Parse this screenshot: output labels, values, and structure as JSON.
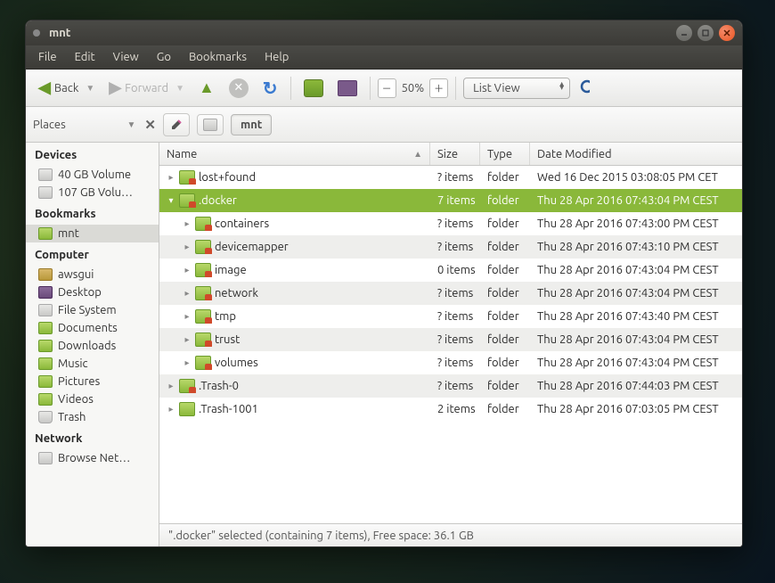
{
  "window": {
    "title": "mnt"
  },
  "menubar": [
    "File",
    "Edit",
    "View",
    "Go",
    "Bookmarks",
    "Help"
  ],
  "toolbar": {
    "back": "Back",
    "forward": "Forward",
    "zoom": "50%",
    "view_mode": "List View"
  },
  "locbar": {
    "places": "Places",
    "crumb": "mnt"
  },
  "sidebar": {
    "sections": [
      {
        "title": "Devices",
        "items": [
          {
            "icon": "drive",
            "label": "40 GB Volume"
          },
          {
            "icon": "drive",
            "label": "107 GB Volu…"
          }
        ]
      },
      {
        "title": "Bookmarks",
        "items": [
          {
            "icon": "folder",
            "label": "mnt",
            "selected": true
          }
        ]
      },
      {
        "title": "Computer",
        "items": [
          {
            "icon": "home",
            "label": "awsgui"
          },
          {
            "icon": "desktop",
            "label": "Desktop"
          },
          {
            "icon": "drive",
            "label": "File System"
          },
          {
            "icon": "folder",
            "label": "Documents"
          },
          {
            "icon": "folder",
            "label": "Downloads"
          },
          {
            "icon": "folder",
            "label": "Music"
          },
          {
            "icon": "folder",
            "label": "Pictures"
          },
          {
            "icon": "folder",
            "label": "Videos"
          },
          {
            "icon": "trash",
            "label": "Trash"
          }
        ]
      },
      {
        "title": "Network",
        "items": [
          {
            "icon": "drive",
            "label": "Browse Net…"
          }
        ]
      }
    ]
  },
  "columns": {
    "name": "Name",
    "size": "Size",
    "type": "Type",
    "date": "Date Modified"
  },
  "rows": [
    {
      "depth": 0,
      "exp": "▸",
      "locked": true,
      "name": "lost+found",
      "size": "? items",
      "type": "folder",
      "date": "Wed 16 Dec 2015 03:08:05 PM CET",
      "alt": false,
      "sel": false
    },
    {
      "depth": 0,
      "exp": "▾",
      "locked": true,
      "name": ".docker",
      "size": "7 items",
      "type": "folder",
      "date": "Thu 28 Apr 2016 07:43:04 PM CEST",
      "alt": false,
      "sel": true
    },
    {
      "depth": 1,
      "exp": "▸",
      "locked": true,
      "name": "containers",
      "size": "? items",
      "type": "folder",
      "date": "Thu 28 Apr 2016 07:43:00 PM CEST",
      "alt": false,
      "sel": false
    },
    {
      "depth": 1,
      "exp": "▸",
      "locked": true,
      "name": "devicemapper",
      "size": "? items",
      "type": "folder",
      "date": "Thu 28 Apr 2016 07:43:10 PM CEST",
      "alt": true,
      "sel": false
    },
    {
      "depth": 1,
      "exp": "▸",
      "locked": true,
      "name": "image",
      "size": "0 items",
      "type": "folder",
      "date": "Thu 28 Apr 2016 07:43:04 PM CEST",
      "alt": false,
      "sel": false
    },
    {
      "depth": 1,
      "exp": "▸",
      "locked": true,
      "name": "network",
      "size": "? items",
      "type": "folder",
      "date": "Thu 28 Apr 2016 07:43:04 PM CEST",
      "alt": true,
      "sel": false
    },
    {
      "depth": 1,
      "exp": "▸",
      "locked": true,
      "name": "tmp",
      "size": "? items",
      "type": "folder",
      "date": "Thu 28 Apr 2016 07:43:40 PM CEST",
      "alt": false,
      "sel": false
    },
    {
      "depth": 1,
      "exp": "▸",
      "locked": true,
      "name": "trust",
      "size": "? items",
      "type": "folder",
      "date": "Thu 28 Apr 2016 07:43:04 PM CEST",
      "alt": true,
      "sel": false
    },
    {
      "depth": 1,
      "exp": "▸",
      "locked": true,
      "name": "volumes",
      "size": "? items",
      "type": "folder",
      "date": "Thu 28 Apr 2016 07:43:04 PM CEST",
      "alt": false,
      "sel": false
    },
    {
      "depth": 0,
      "exp": "▸",
      "locked": true,
      "name": ".Trash-0",
      "size": "? items",
      "type": "folder",
      "date": "Thu 28 Apr 2016 07:44:03 PM CEST",
      "alt": true,
      "sel": false
    },
    {
      "depth": 0,
      "exp": "▸",
      "locked": false,
      "name": ".Trash-1001",
      "size": "2 items",
      "type": "folder",
      "date": "Thu 28 Apr 2016 07:03:05 PM CEST",
      "alt": false,
      "sel": false
    }
  ],
  "status": "\".docker\" selected (containing 7 items), Free space: 36.1 GB"
}
